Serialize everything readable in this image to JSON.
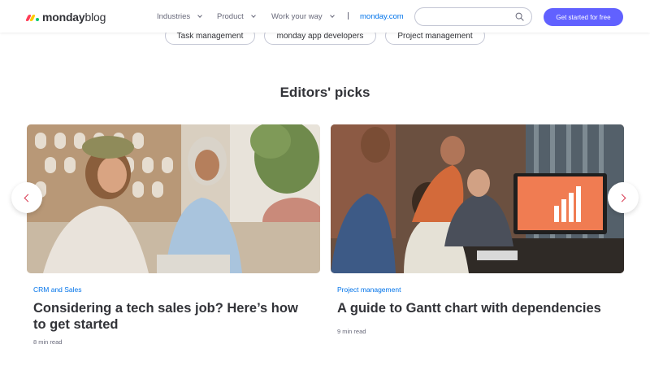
{
  "header": {
    "logo_bold": "monday",
    "logo_light": "blog",
    "nav": [
      {
        "label": "Industries"
      },
      {
        "label": "Product"
      },
      {
        "label": "Work your way"
      }
    ],
    "link": "monday.com",
    "search_placeholder": "",
    "cta": "Get started for free"
  },
  "tags": [
    "Task management",
    "monday app developers",
    "Project management"
  ],
  "section_title": "Editors' picks",
  "cards": [
    {
      "category": "CRM and Sales",
      "title": "Considering a tech sales job? Here’s how to get started",
      "read_time": "8 min read"
    },
    {
      "category": "Project management",
      "title": "A guide to Gantt chart with dependencies",
      "read_time": "9 min read"
    }
  ],
  "colors": {
    "brand_purple": "#6161ff",
    "link_blue": "#0073ea",
    "arrow_red": "#d83a52"
  },
  "icons": {
    "search": "search-icon",
    "prev": "chevron-left-icon",
    "next": "chevron-right-icon"
  }
}
